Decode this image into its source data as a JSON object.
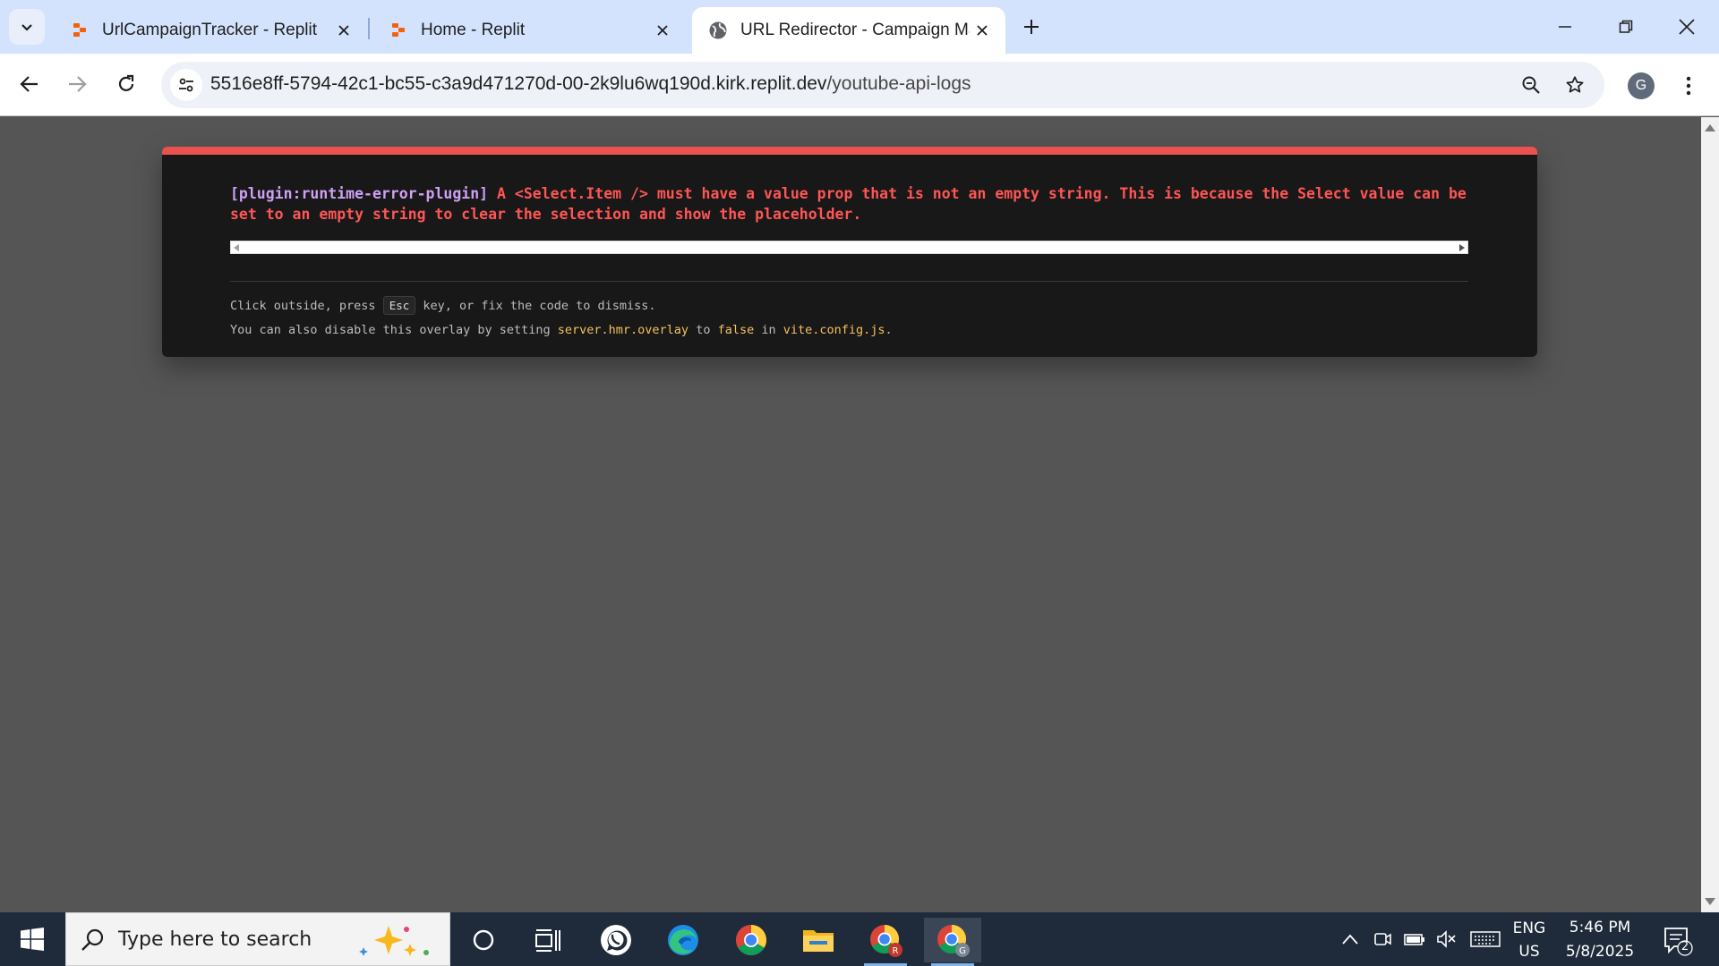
{
  "browser": {
    "tabs": [
      {
        "title": "UrlCampaignTracker - Replit",
        "favicon": "replit-icon",
        "active": false
      },
      {
        "title": "Home - Replit",
        "favicon": "replit-icon",
        "active": false
      },
      {
        "title": "URL Redirector - Campaign Man",
        "favicon": "globe-icon",
        "active": true
      }
    ],
    "url_host": "5516e8ff-5794-42c1-bc55-c3a9d471270d-00-2k9lu6wq190d.kirk.replit.dev",
    "url_path": "/youtube-api-logs",
    "avatar_letter": "G"
  },
  "overlay": {
    "plugin": "[plugin:runtime-error-plugin]",
    "message": " A <Select.Item /> must have a value prop that is not an empty string. This is because the Select value can be set to an empty string to clear the selection and show the placeholder.",
    "tip1_before": "Click outside, press ",
    "tip1_key": "Esc",
    "tip1_after": " key, or fix the code to dismiss.",
    "tip2_before": "You can also disable this overlay by setting ",
    "tip2_code1": "server.hmr.overlay",
    "tip2_mid1": " to ",
    "tip2_code2": "false",
    "tip2_mid2": " in ",
    "tip2_code3": "vite.config.js",
    "tip2_after": ".",
    "accent_color": "#e9524f"
  },
  "taskbar": {
    "search_placeholder": "Type here to search",
    "language": "ENG",
    "region": "US",
    "time": "5:46 PM",
    "date": "5/8/2025",
    "notification_count": "2",
    "apps": [
      "cortana-icon",
      "task-view-icon",
      "whatsapp-icon",
      "edge-icon",
      "chrome-icon",
      "file-explorer-icon",
      "chrome-profile-r-icon",
      "chrome-profile-g-icon"
    ]
  }
}
